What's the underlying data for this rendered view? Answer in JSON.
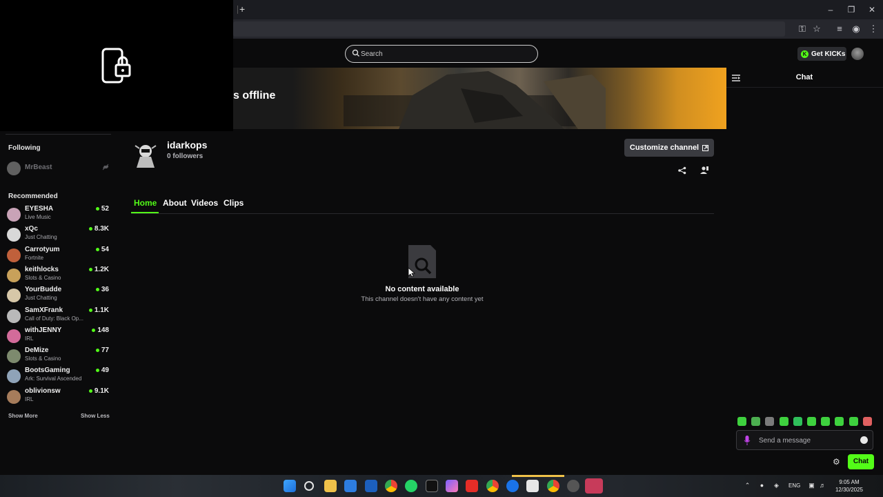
{
  "browser": {
    "new_tab_label": "+",
    "window_controls": [
      "minimize-icon",
      "restore-icon",
      "close-icon"
    ]
  },
  "header": {
    "search_placeholder": "Search",
    "get_kicks_label": "Get KICKs"
  },
  "banner": {
    "offline_text": "s offline"
  },
  "sidebar": {
    "following_heading": "Following",
    "following": [
      {
        "name": "MrBeast"
      }
    ],
    "recommended_heading": "Recommended",
    "recommended": [
      {
        "name": "EYESHA",
        "category": "Live Music",
        "viewers": "52",
        "color": "#c9a3b7"
      },
      {
        "name": "xQc",
        "category": "Just Chatting",
        "viewers": "8.3K",
        "color": "#d8d8d8"
      },
      {
        "name": "Carrotyum",
        "category": "Fortnite",
        "viewers": "54",
        "color": "#c0603b"
      },
      {
        "name": "keithlocks",
        "category": "Slots & Casino",
        "viewers": "1.2K",
        "color": "#c8a15a"
      },
      {
        "name": "YourBudde",
        "category": "Just Chatting",
        "viewers": "36",
        "color": "#d6c7a8"
      },
      {
        "name": "SamXFrank",
        "category": "Call of Duty: Black Op...",
        "viewers": "1.1K",
        "color": "#b9b9b9"
      },
      {
        "name": "withJENNY",
        "category": "IRL",
        "viewers": "148",
        "color": "#d36b9a"
      },
      {
        "name": "DeMize",
        "category": "Slots & Casino",
        "viewers": "77",
        "color": "#7d8a6e"
      },
      {
        "name": "BootsGaming",
        "category": "Ark: Survival Ascended",
        "viewers": "49",
        "color": "#8fa3b8"
      },
      {
        "name": "oblivionsw",
        "category": "IRL",
        "viewers": "9.1K",
        "color": "#a67c5b"
      }
    ],
    "show_more": "Show More",
    "show_less": "Show Less"
  },
  "channel": {
    "name": "idarkops",
    "followers": "0 followers",
    "customize_label": "Customize channel",
    "tabs": [
      "Home",
      "About",
      "Videos",
      "Clips"
    ],
    "active_tab": "Home",
    "empty_title": "No content available",
    "empty_subtitle": "This channel doesn't have any content yet"
  },
  "chat": {
    "title": "Chat",
    "message_placeholder": "Send a message",
    "send_label": "Chat"
  },
  "taskbar": {
    "language": "ENG",
    "time": "9:05 AM",
    "date": "12/30/2025"
  },
  "colors": {
    "accent": "#53fc18",
    "background": "#0b0b0c"
  }
}
